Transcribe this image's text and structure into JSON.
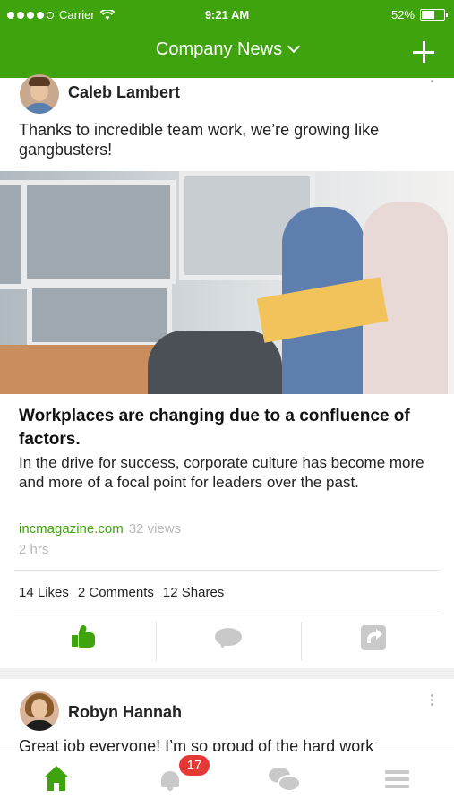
{
  "status_bar": {
    "carrier": "Carrier",
    "time": "9:21 AM",
    "battery": "52%"
  },
  "nav": {
    "title": "Company News"
  },
  "posts": [
    {
      "author": "Caleb Lambert",
      "text": "Thanks to incredible team work, we’re growing like gangbusters!",
      "article": {
        "headline": "Workplaces are changing due to a confluence of factors.",
        "summary": "In the drive for success, corporate culture has become more and more of a focal point for leaders over the past.",
        "source": "incmagazine.com",
        "views": "32 views",
        "time": "2 hrs"
      },
      "stats": {
        "likes": "14 Likes",
        "comments": "2 Comments",
        "shares": "12 Shares"
      }
    },
    {
      "author": "Robyn Hannah",
      "text": "Great job everyone! I’m so proud of the hard work"
    }
  ],
  "tabbar": {
    "notifications_badge": "17"
  },
  "colors": {
    "brand": "#3fa30d",
    "badge": "#e53935",
    "muted": "#c9c9c9"
  },
  "icons": [
    "wifi-icon",
    "chevron-down-icon",
    "plus-icon",
    "kebab-menu-icon",
    "like-icon",
    "comment-icon",
    "share-icon",
    "home-icon",
    "bell-icon",
    "chat-icon",
    "menu-icon"
  ]
}
